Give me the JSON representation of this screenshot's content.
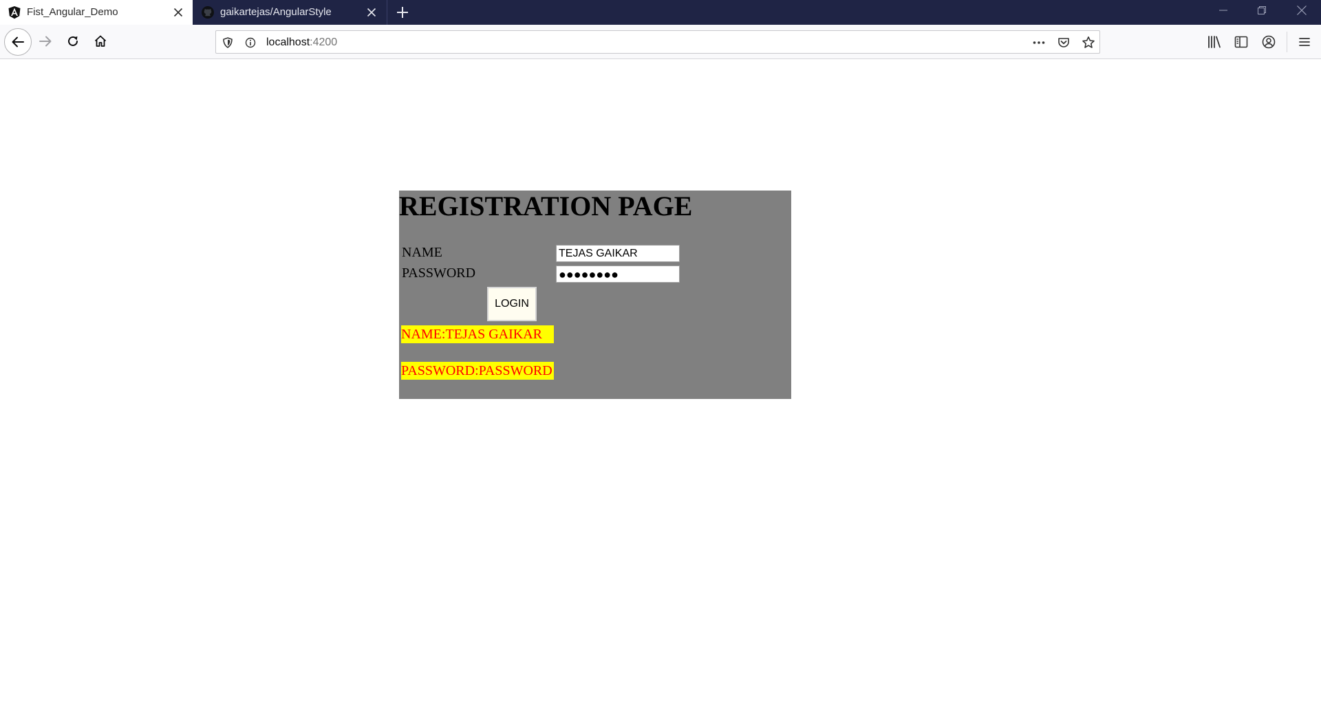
{
  "browser": {
    "tabs": [
      {
        "title": "Fist_Angular_Demo",
        "favicon": "angular-icon",
        "active": true
      },
      {
        "title": "gaikartejas/AngularStyle",
        "favicon": "github-icon",
        "active": false
      }
    ],
    "url_host": "localhost",
    "url_port": ":4200",
    "colors": {
      "tabstrip": "#1f2445",
      "navbar": "#f9f9fb"
    }
  },
  "page": {
    "heading": "REGISTRATION PAGE",
    "name_label": "NAME",
    "password_label": "PASSWORD",
    "name_value": "TEJAS GAIKAR",
    "password_mask": "●●●●●●●●",
    "login_label": "LOGIN",
    "name_output": "NAME:TEJAS GAIKAR",
    "password_output": "PASSWORD:PASSWORD",
    "colors": {
      "panel": "#808080",
      "highlight": "#ffff00",
      "output_text": "#ff0000"
    }
  }
}
